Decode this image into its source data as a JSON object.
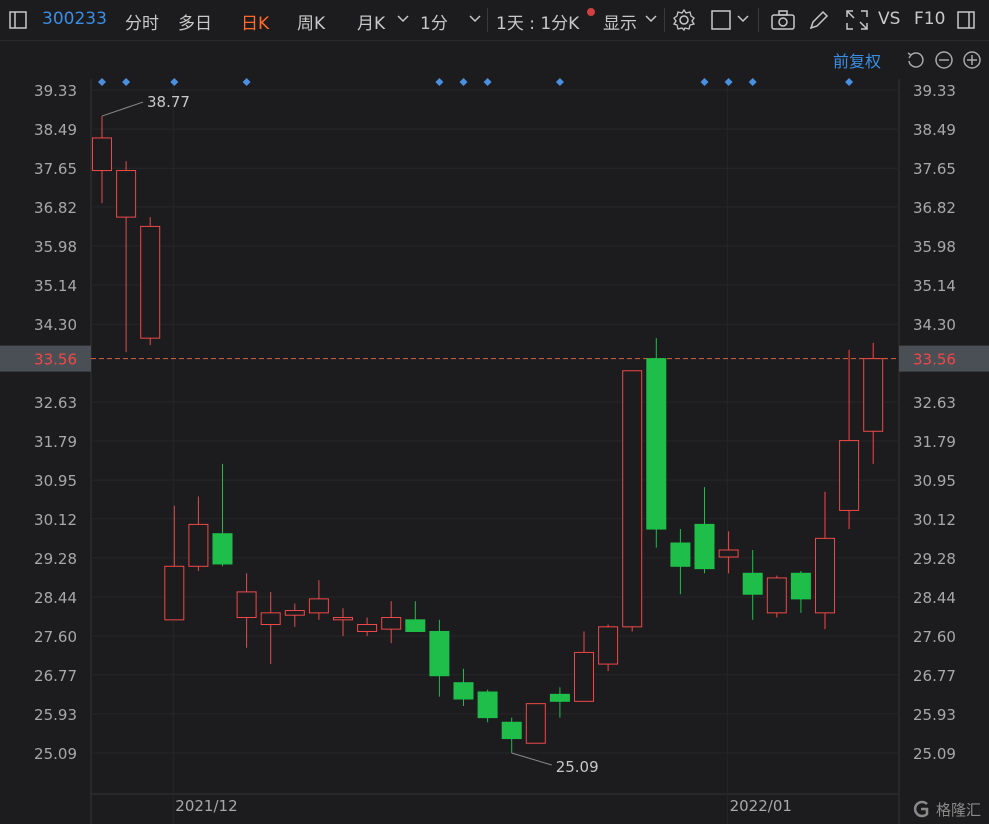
{
  "toolbar": {
    "code": "300233",
    "tabs": [
      "分时",
      "多日",
      "日K",
      "周K",
      "月K",
      "1分"
    ],
    "active_tab": "日K",
    "range": "1天 : 1分K",
    "display": "显示",
    "vs": "VS",
    "f10": "F10"
  },
  "subbar": {
    "adjust": "前复权"
  },
  "watermark": "格隆汇",
  "colors": {
    "up": "#f04848",
    "down": "#1fbe4a",
    "axis": "#a8a8a8",
    "last": "#f04848",
    "marker": "#4a90e2",
    "bg": "#1c1c1e"
  },
  "chart_data": {
    "type": "candlestick",
    "y_ticks": [
      "39.33",
      "38.49",
      "37.65",
      "36.82",
      "35.98",
      "35.14",
      "34.30",
      "33.56",
      "32.63",
      "31.79",
      "30.95",
      "30.12",
      "29.28",
      "28.44",
      "27.60",
      "26.77",
      "25.93",
      "25.09"
    ],
    "ylim": [
      24.55,
      39.33
    ],
    "x_labels": [
      {
        "label": "2021/12",
        "index": 3
      },
      {
        "label": "2022/01",
        "index": 26
      }
    ],
    "last_price": "33.56",
    "annotations": [
      {
        "text": "38.77",
        "index": 0,
        "value": 38.77
      },
      {
        "text": "25.09",
        "index": 17,
        "value": 25.09
      }
    ],
    "marker_indices": [
      0,
      1,
      3,
      6,
      14,
      15,
      16,
      19,
      25,
      26,
      27,
      31
    ],
    "candles": [
      {
        "o": 37.6,
        "h": 38.77,
        "l": 36.9,
        "c": 38.3
      },
      {
        "o": 36.6,
        "h": 37.8,
        "l": 33.7,
        "c": 37.6
      },
      {
        "o": 34.0,
        "h": 36.6,
        "l": 33.85,
        "c": 36.4
      },
      {
        "o": 27.95,
        "h": 30.4,
        "l": 27.95,
        "c": 29.1
      },
      {
        "o": 29.1,
        "h": 30.6,
        "l": 29.0,
        "c": 30.0
      },
      {
        "o": 29.8,
        "h": 31.3,
        "l": 29.1,
        "c": 29.15
      },
      {
        "o": 28.0,
        "h": 28.95,
        "l": 27.35,
        "c": 28.55
      },
      {
        "o": 27.85,
        "h": 28.55,
        "l": 27.0,
        "c": 28.1
      },
      {
        "o": 28.05,
        "h": 28.3,
        "l": 27.8,
        "c": 28.15
      },
      {
        "o": 28.1,
        "h": 28.8,
        "l": 27.95,
        "c": 28.4
      },
      {
        "o": 27.95,
        "h": 28.2,
        "l": 27.6,
        "c": 28.0
      },
      {
        "o": 27.7,
        "h": 28.0,
        "l": 27.6,
        "c": 27.85
      },
      {
        "o": 27.75,
        "h": 28.35,
        "l": 27.45,
        "c": 28.0
      },
      {
        "o": 27.95,
        "h": 28.35,
        "l": 27.7,
        "c": 27.7
      },
      {
        "o": 27.7,
        "h": 27.95,
        "l": 26.3,
        "c": 26.75
      },
      {
        "o": 26.6,
        "h": 26.9,
        "l": 26.1,
        "c": 26.25
      },
      {
        "o": 26.4,
        "h": 26.45,
        "l": 25.75,
        "c": 25.85
      },
      {
        "o": 25.75,
        "h": 25.85,
        "l": 25.09,
        "c": 25.4
      },
      {
        "o": 25.3,
        "h": 26.15,
        "l": 25.3,
        "c": 26.15
      },
      {
        "o": 26.35,
        "h": 26.5,
        "l": 25.85,
        "c": 26.2
      },
      {
        "o": 26.2,
        "h": 27.7,
        "l": 26.2,
        "c": 27.25
      },
      {
        "o": 27.0,
        "h": 27.85,
        "l": 26.85,
        "c": 27.8
      },
      {
        "o": 27.8,
        "h": 33.3,
        "l": 27.7,
        "c": 33.3
      },
      {
        "o": 33.56,
        "h": 34.0,
        "l": 29.5,
        "c": 29.9
      },
      {
        "o": 29.6,
        "h": 29.9,
        "l": 28.5,
        "c": 29.1
      },
      {
        "o": 30.0,
        "h": 30.8,
        "l": 28.95,
        "c": 29.05
      },
      {
        "o": 29.3,
        "h": 29.85,
        "l": 28.95,
        "c": 29.45
      },
      {
        "o": 28.95,
        "h": 29.45,
        "l": 27.95,
        "c": 28.5
      },
      {
        "o": 28.1,
        "h": 28.9,
        "l": 28.0,
        "c": 28.85
      },
      {
        "o": 28.95,
        "h": 29.0,
        "l": 28.1,
        "c": 28.4
      },
      {
        "o": 28.1,
        "h": 30.7,
        "l": 27.75,
        "c": 29.7
      },
      {
        "o": 30.3,
        "h": 33.75,
        "l": 29.9,
        "c": 31.8
      },
      {
        "o": 32.0,
        "h": 33.9,
        "l": 31.3,
        "c": 33.56
      }
    ]
  }
}
